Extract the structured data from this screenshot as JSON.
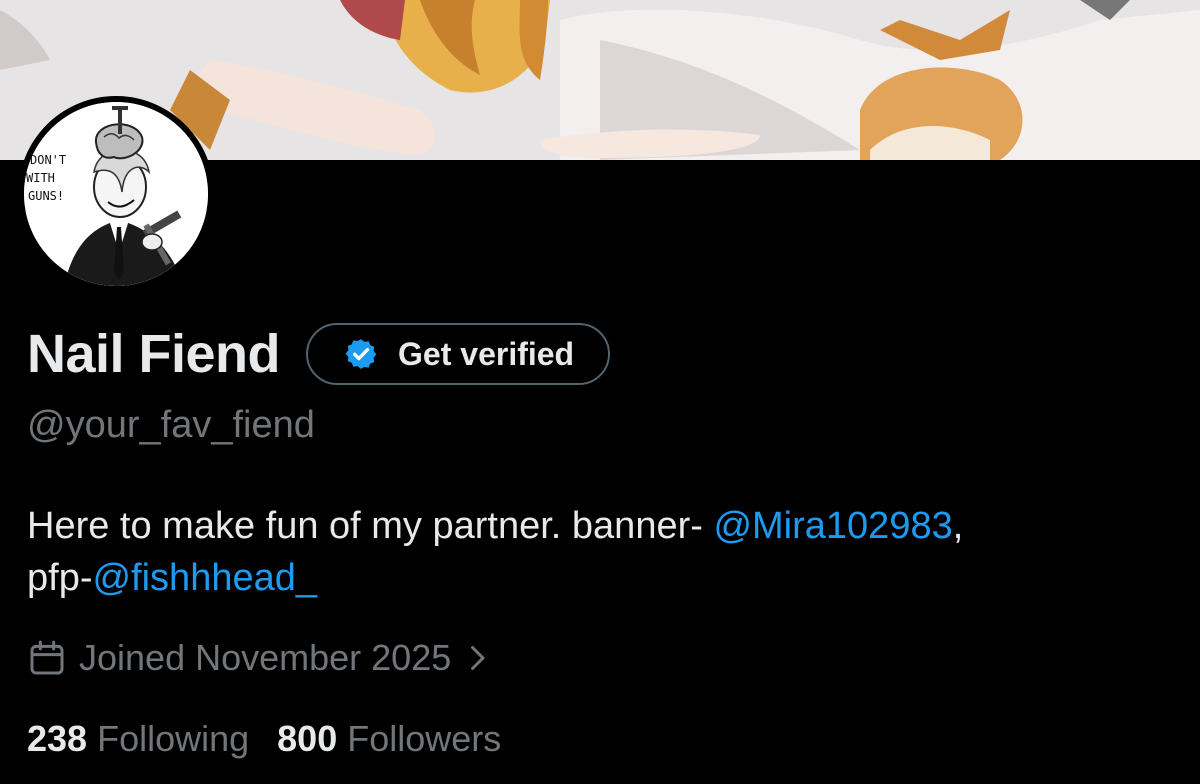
{
  "profile": {
    "display_name": "Nail Fiend",
    "handle": "@your_fav_fiend",
    "verify_button": "Get verified",
    "bio": {
      "text_1": "Here to make fun of my partner. banner- ",
      "mention_1": "@Mira102983",
      "text_2": ",",
      "text_3": "pfp-",
      "mention_2": "@fishhhead_"
    },
    "joined": "Joined November 2025",
    "stats": {
      "following_count": "238",
      "following_label": "Following",
      "followers_count": "800",
      "followers_label": "Followers"
    },
    "avatar_text": "DON'T WITH GUNS!"
  },
  "icons": {
    "verified": "verified-badge-icon",
    "calendar": "calendar-icon",
    "chevron": "chevron-right-icon"
  },
  "colors": {
    "background": "#000000",
    "primary_text": "#e7e9ea",
    "secondary_text": "#71767b",
    "link": "#1d9bf0",
    "border": "#536471"
  }
}
